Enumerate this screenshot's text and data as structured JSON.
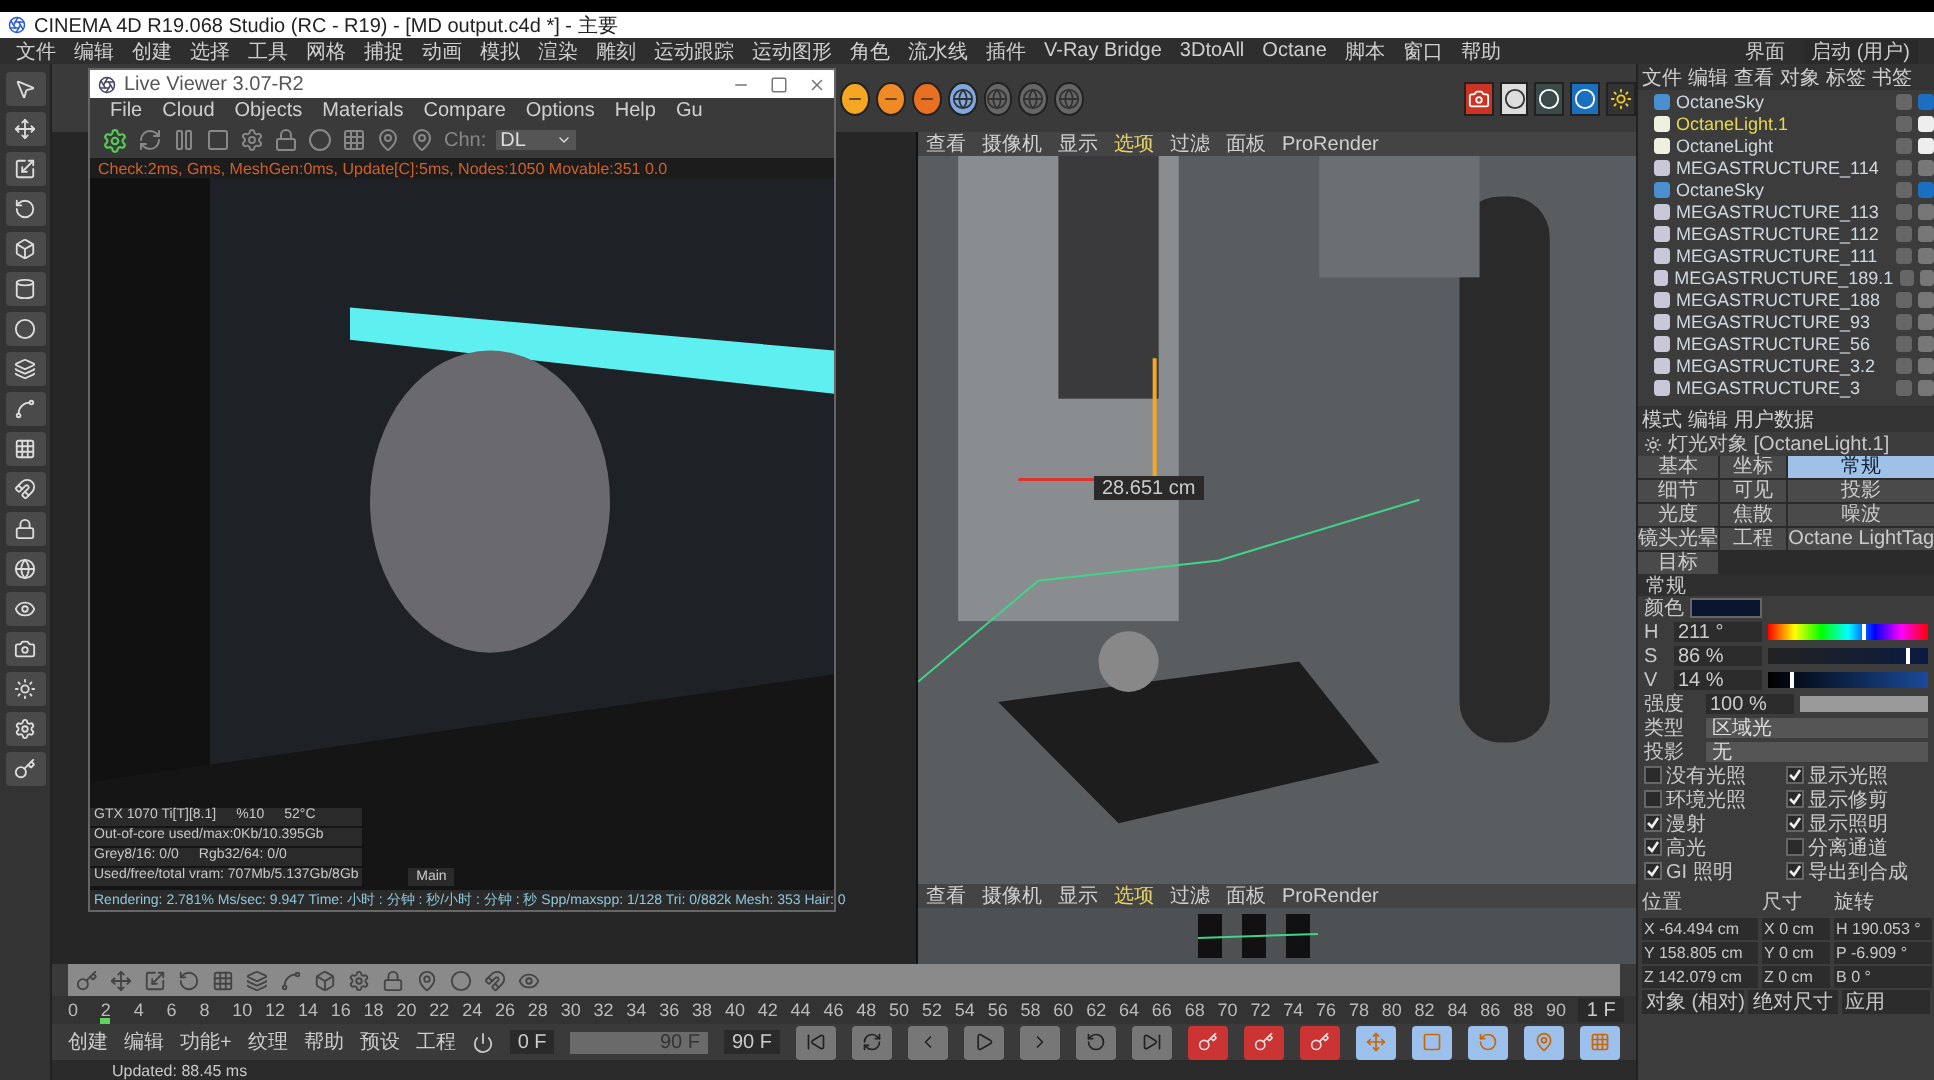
{
  "app_title": "CINEMA 4D R19.068 Studio (RC - R19) - [MD output.c4d *] - 主要",
  "menu": [
    "文件",
    "编辑",
    "创建",
    "选择",
    "工具",
    "网格",
    "捕捉",
    "动画",
    "模拟",
    "渲染",
    "雕刻",
    "运动跟踪",
    "运动图形",
    "角色",
    "流水线",
    "插件",
    "V-Ray Bridge",
    "3DtoAll",
    "Octane",
    "脚本",
    "窗口",
    "帮助"
  ],
  "layout": {
    "label": "界面",
    "value": "启动 (用户)"
  },
  "live_viewer": {
    "title": "Live Viewer 3.07-R2",
    "menu": [
      "File",
      "Cloud",
      "Objects",
      "Materials",
      "Compare",
      "Options",
      "Help",
      "Gu"
    ],
    "channel": {
      "label": "Chn:",
      "value": "DL"
    },
    "status": "Check:2ms, Gms, MeshGen:0ms, Update[C]:5ms, Nodes:1050 Movable:351  0.0",
    "gpu_info": [
      {
        "cells": [
          "GTX 1070 Ti[T][8.1]",
          "%10",
          "52°C"
        ]
      },
      {
        "cells": [
          "Out-of-core used/max:0Kb/10.395Gb"
        ]
      },
      {
        "cells": [
          "Grey8/16: 0/0",
          "Rgb32/64: 0/0"
        ]
      },
      {
        "cells": [
          "Used/free/total vram: 707Mb/5.137Gb/8Gb"
        ]
      }
    ],
    "view_select": "Main",
    "stats": "Rendering: 2.781%  Ms/sec: 9.947   Time: 小时 : 分钟 : 秒/小时 : 分钟 : 秒   Spp/maxspp: 1/128   Tri: 0/882k   Mesh: 353  Hair: 0"
  },
  "viewport": {
    "menu": [
      {
        "label": "查看",
        "selected": false
      },
      {
        "label": "摄像机",
        "selected": false
      },
      {
        "label": "显示",
        "selected": false
      },
      {
        "label": "选项",
        "selected": true
      },
      {
        "label": "过滤",
        "selected": false
      },
      {
        "label": "面板",
        "selected": false
      },
      {
        "label": "ProRender",
        "selected": false
      }
    ],
    "measure": "28.651 cm"
  },
  "viewport_bottom": {
    "menu": [
      {
        "label": "查看",
        "selected": false
      },
      {
        "label": "摄像机",
        "selected": false
      },
      {
        "label": "显示",
        "selected": false
      },
      {
        "label": "选项",
        "selected": true
      },
      {
        "label": "过滤",
        "selected": false
      },
      {
        "label": "面板",
        "selected": false
      },
      {
        "label": "ProRender",
        "selected": false
      }
    ]
  },
  "object_manager": {
    "menu": [
      "文件",
      "编辑",
      "查看",
      "对象",
      "标签",
      "书签"
    ],
    "objects": [
      {
        "name": "OctaneSky",
        "kind": "sky",
        "selected": false
      },
      {
        "name": "OctaneLight.1",
        "kind": "light",
        "selected": true
      },
      {
        "name": "OctaneLight",
        "kind": "light",
        "selected": false
      },
      {
        "name": "MEGASTRUCTURE_114",
        "kind": "mesh",
        "selected": false
      },
      {
        "name": "OctaneSky",
        "kind": "sky",
        "selected": false
      },
      {
        "name": "MEGASTRUCTURE_113",
        "kind": "mesh",
        "selected": false
      },
      {
        "name": "MEGASTRUCTURE_112",
        "kind": "mesh",
        "selected": false
      },
      {
        "name": "MEGASTRUCTURE_111",
        "kind": "mesh",
        "selected": false
      },
      {
        "name": "MEGASTRUCTURE_189.1",
        "kind": "mesh",
        "selected": false
      },
      {
        "name": "MEGASTRUCTURE_188",
        "kind": "mesh",
        "selected": false
      },
      {
        "name": "MEGASTRUCTURE_93",
        "kind": "mesh",
        "selected": false
      },
      {
        "name": "MEGASTRUCTURE_56",
        "kind": "mesh",
        "selected": false
      },
      {
        "name": "MEGASTRUCTURE_3.2",
        "kind": "mesh",
        "selected": false
      },
      {
        "name": "MEGASTRUCTURE_3",
        "kind": "mesh",
        "selected": false
      }
    ]
  },
  "attributes": {
    "menu": [
      "模式",
      "编辑",
      "用户数据"
    ],
    "object_title": "灯光对象 [OctaneLight.1]",
    "tabs": [
      {
        "label": "基本",
        "selected": false
      },
      {
        "label": "坐标",
        "selected": false
      },
      {
        "label": "常规",
        "selected": true
      },
      {
        "label": "细节",
        "selected": false
      },
      {
        "label": "可见",
        "selected": false
      },
      {
        "label": "投影",
        "selected": false
      },
      {
        "label": "光度",
        "selected": false
      },
      {
        "label": "焦散",
        "selected": false
      },
      {
        "label": "噪波",
        "selected": false
      },
      {
        "label": "镜头光晕",
        "selected": false
      },
      {
        "label": "工程",
        "selected": false
      },
      {
        "label": "Octane LightTag",
        "selected": false
      },
      {
        "label": "目标",
        "selected": false
      }
    ],
    "section": "常规",
    "color_label": "颜色",
    "color": "#0a1630",
    "hsv": [
      {
        "label": "H",
        "value": "211 °",
        "level": 0.586,
        "kind": "hue"
      },
      {
        "label": "S",
        "value": "86 %",
        "level": 0.86,
        "kind": "sat"
      },
      {
        "label": "V",
        "value": "14 %",
        "level": 0.14,
        "kind": "val"
      }
    ],
    "fields": [
      {
        "label": "强度",
        "value": "100 %",
        "level": 1,
        "kind": "slider"
      },
      {
        "label": "类型",
        "value": "区域光",
        "kind": "select"
      },
      {
        "label": "投影",
        "value": "无",
        "kind": "select"
      }
    ],
    "checks": [
      {
        "label": "没有光照",
        "checked": false
      },
      {
        "label": "显示光照",
        "checked": true
      },
      {
        "label": "环境光照",
        "checked": false
      },
      {
        "label": "显示修剪",
        "checked": true
      },
      {
        "label": "漫射",
        "checked": true
      },
      {
        "label": "显示照明",
        "checked": true
      },
      {
        "label": "高光",
        "checked": true
      },
      {
        "label": "分离通道",
        "checked": false
      },
      {
        "label": "GI 照明",
        "checked": true
      },
      {
        "label": "导出到合成",
        "checked": true
      }
    ]
  },
  "coordinates": {
    "headers": [
      "位置",
      "尺寸",
      "旋转"
    ],
    "rows": [
      {
        "cells": [
          {
            "axis": "X",
            "value": "-64.494 cm"
          },
          {
            "axis": "X",
            "value": "0 cm"
          },
          {
            "axis": "H",
            "value": "190.053 °"
          }
        ]
      },
      {
        "cells": [
          {
            "axis": "Y",
            "value": "158.805 cm"
          },
          {
            "axis": "Y",
            "value": "0 cm"
          },
          {
            "axis": "P",
            "value": "-6.909 °"
          }
        ]
      },
      {
        "cells": [
          {
            "axis": "Z",
            "value": "142.079 cm"
          },
          {
            "axis": "Z",
            "value": "0 cm"
          },
          {
            "axis": "B",
            "value": "0 °"
          }
        ]
      }
    ],
    "selects": [
      "对象 (相对)",
      "绝对尺寸",
      "应用"
    ]
  },
  "timeline": {
    "ticks": [
      "0",
      "2",
      "4",
      "6",
      "8",
      "10",
      "12",
      "14",
      "16",
      "18",
      "20",
      "22",
      "24",
      "26",
      "28",
      "30",
      "32",
      "34",
      "36",
      "38",
      "40",
      "42",
      "44",
      "46",
      "48",
      "50",
      "52",
      "54",
      "56",
      "58",
      "60",
      "62",
      "64",
      "66",
      "68",
      "70",
      "72",
      "74",
      "76",
      "78",
      "80",
      "82",
      "84",
      "86",
      "88",
      "90"
    ],
    "playhead": {
      "level": 0.02
    },
    "frame": "1 F",
    "start": "0 F",
    "end": "90 F",
    "max": "90 F"
  },
  "bottom_menu": [
    "创建",
    "编辑",
    "功能+",
    "纹理",
    "帮助",
    "预设",
    "工程"
  ],
  "status_bar": "Updated: 88.45 ms"
}
